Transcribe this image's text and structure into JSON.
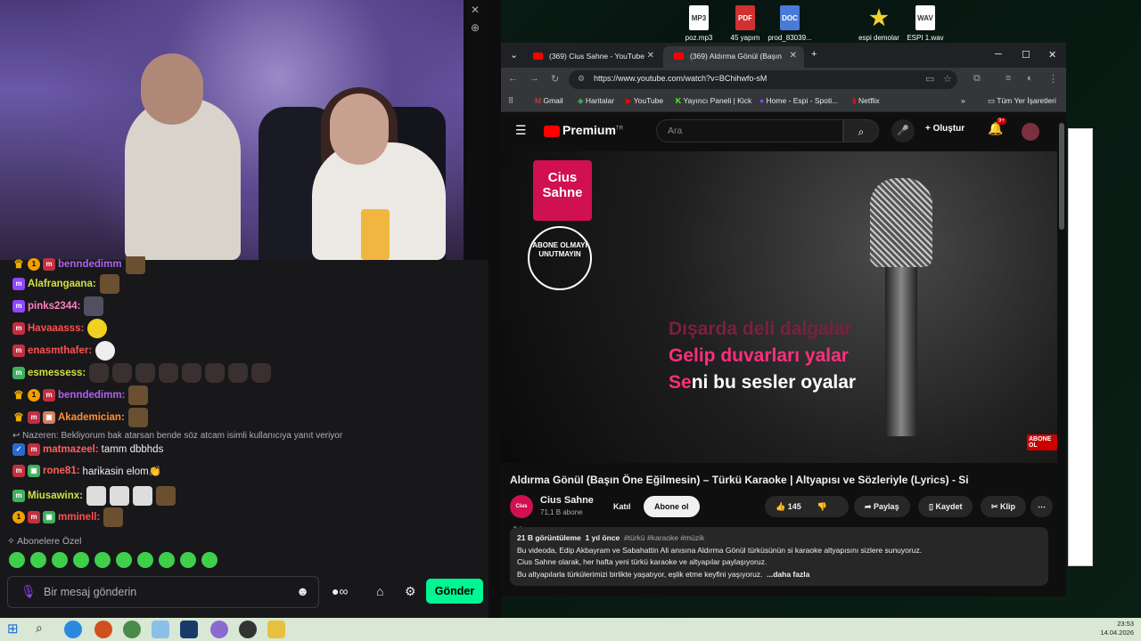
{
  "desktop": {
    "icons": [
      {
        "label": "poz.mp3",
        "kind": "MP3",
        "color": "#ffffff"
      },
      {
        "label": "45 yapım",
        "kind": "PDF",
        "color": "#d03030"
      },
      {
        "label": "prod_83039...",
        "kind": "DOC",
        "color": "#4a7ad8"
      },
      {
        "label": "espi demolar",
        "kind": "★",
        "color": "#f0d030"
      },
      {
        "label": "ESPI 1.wav",
        "kind": "WAV",
        "color": "#ffffff"
      }
    ]
  },
  "stream": {
    "chat_messages": [
      {
        "user": "benndedimm",
        "color": "#b060f0",
        "text": ""
      },
      {
        "user": "Alafrangaana:",
        "color": "#d0e040",
        "text": ""
      },
      {
        "user": "pinks2344:",
        "color": "#ff80c0",
        "text": ""
      },
      {
        "user": "Havaaasss:",
        "color": "#ff5050",
        "text": ""
      },
      {
        "user": "enasmthafer:",
        "color": "#ff5050",
        "text": ""
      },
      {
        "user": "esmessess:",
        "color": "#d0e040",
        "text": ""
      },
      {
        "user": "benndedimm:",
        "color": "#b060f0",
        "text": ""
      },
      {
        "user": "Akademician:",
        "color": "#ff9030",
        "text": ""
      },
      {
        "user": "matmazeel:",
        "color": "#ff6060",
        "text": "tamm dbbhds"
      },
      {
        "user": "rone81:",
        "color": "#ff6060",
        "text": "harikasin elom👏"
      },
      {
        "user": "Miusawinx:",
        "color": "#d0e040",
        "text": ""
      },
      {
        "user": "mminell:",
        "color": "#ff5050",
        "text": ""
      }
    ],
    "reply_note": "↩ Nazeren: Bekliyorum bak atarsan bende söz atcam isimli kullanıcıya yanıt veriyor",
    "sub_only": "✧ Abonelere Özel",
    "input_placeholder": "Bir mesaj gönderin",
    "send_label": "Gönder"
  },
  "browser": {
    "tabs": [
      {
        "title": "(369) Cius Sahne - YouTube"
      },
      {
        "title": "(369) Aldırma Gönül (Başın"
      }
    ],
    "url": "https://www.youtube.com/watch?v=BChihwfo-sM",
    "bookmarks": [
      "Gmail",
      "Haritalar",
      "YouTube",
      "Yayıncı Paneli | Kick",
      "Home - Espi - Spoti...",
      "Netflix"
    ],
    "all_bookmarks": "Tüm Yer İşaretleri"
  },
  "youtube": {
    "brand": "Premium",
    "region": "TR",
    "search_placeholder": "Ara",
    "create_label": "Oluştur",
    "notif_count": "9+",
    "video": {
      "logo_text": "Cius Sahne",
      "stamp_text": "ABONE OLMAYI UNUTMAYIN",
      "lyric_1": "Dışarda deli dalgalar",
      "lyric_2": "Gelip duvarları yalar",
      "lyric_3_hl": "Se",
      "lyric_3_rest": "ni bu sesler oyalar",
      "sub_badge": "ABONE OL"
    },
    "title": "Aldırma Gönül (Başın Öne Eğilmesin) – Türkü Karaoke | Altyapısı ve Sözleriyle (Lyrics) - Si",
    "channel": "Cius Sahne",
    "subscribers": "71,1 B abone",
    "join_label": "Katıl",
    "subscribe_label": "Abone ol",
    "likes": "145",
    "share_label": "Paylaş",
    "save_label": "Kaydet",
    "clip_label": "Klip",
    "desc": {
      "views": "21 B görüntüleme",
      "age": "1 yıl önce",
      "tags": "#türkü #karaoke #müzik",
      "line1": "Bu videoda, Edip Akbayram ve Sabahattin Ali anısına Aldırma Gönül türküsünün si karaoke altyapısını sizlere sunuyoruz.",
      "line2": "Cius Sahne olarak, her hafta yeni türkü karaoke ve altyapılar paylaşıyoruz.",
      "line3": "Bu altyapılarla türkülerimizi birlikte yaşatıyor, eşlik etme keyfini yaşıyoruz.",
      "more": "...daha fazla"
    }
  },
  "taskbar": {
    "time": "23:53",
    "date": "14.04.2026"
  }
}
